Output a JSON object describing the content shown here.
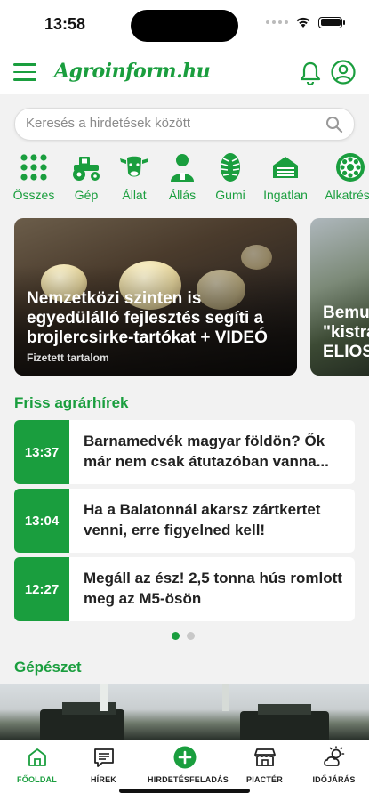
{
  "status": {
    "time": "13:58"
  },
  "header": {
    "logo": "Agroinform.hu"
  },
  "search": {
    "placeholder": "Keresés a hirdetések között"
  },
  "categories": [
    {
      "label": "Összes",
      "icon": "grid-icon"
    },
    {
      "label": "Gép",
      "icon": "tractor-icon"
    },
    {
      "label": "Állat",
      "icon": "cow-icon"
    },
    {
      "label": "Állás",
      "icon": "person-icon"
    },
    {
      "label": "Gumi",
      "icon": "tire-icon"
    },
    {
      "label": "Ingatlan",
      "icon": "barn-icon"
    },
    {
      "label": "Alkatrész",
      "icon": "gear-part-icon"
    }
  ],
  "featured": [
    {
      "title": "Nemzetközi szinten is egyedülálló fejlesztés segíti a brojlercsirke-tartókat + VIDEÓ",
      "label": "Fizetett tartalom"
    },
    {
      "title": "Bemu\n\"kistra\nELIOS"
    }
  ],
  "fresh_news": {
    "title": "Friss agrárhírek",
    "items": [
      {
        "time": "13:37",
        "title": "Barnamedvék magyar földön? Ők már nem csak átutazóban vanna..."
      },
      {
        "time": "13:04",
        "title": "Ha a Balatonnál akarsz zártkertet venni, erre figyelned kell!"
      },
      {
        "time": "12:27",
        "title": "Megáll az ész! 2,5 tonna hús romlott meg az M5-ösön"
      }
    ]
  },
  "machinery": {
    "title": "Gépészet"
  },
  "tabbar": [
    {
      "label": "FŐOLDAL",
      "icon": "home-icon",
      "active": true
    },
    {
      "label": "HÍREK",
      "icon": "news-icon",
      "active": false
    },
    {
      "label": "HIRDETÉSFELADÁS",
      "icon": "plus-circle-icon",
      "active": false
    },
    {
      "label": "PIACTÉR",
      "icon": "store-icon",
      "active": false
    },
    {
      "label": "IDŐJÁRÁS",
      "icon": "weather-icon",
      "active": false
    }
  ],
  "colors": {
    "brand": "#1a9e3e",
    "background": "#f2f2f2"
  }
}
